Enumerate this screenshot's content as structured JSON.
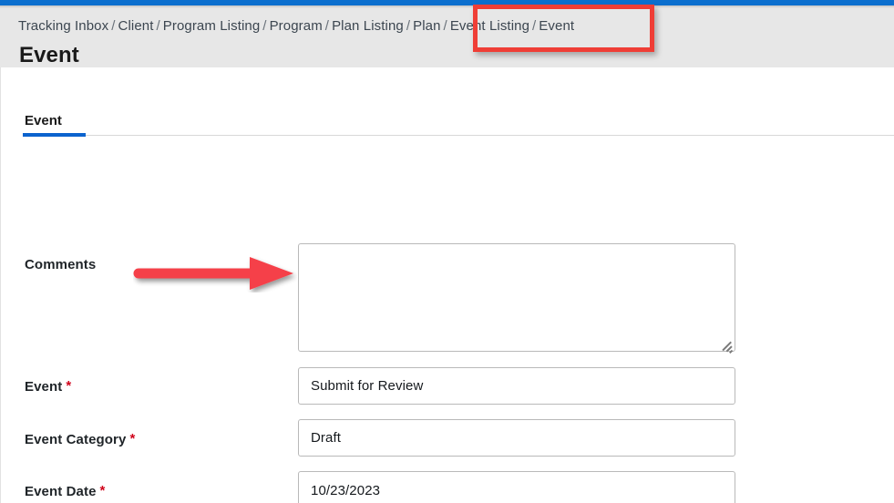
{
  "window": {
    "accent_blue": "#0b6fce",
    "header_bg": "#e7e7e7",
    "annotation_red": "#ef3e36",
    "required_red": "#d0021b"
  },
  "breadcrumb": {
    "separator": "/",
    "items": [
      {
        "label": "Tracking Inbox"
      },
      {
        "label": "Client"
      },
      {
        "label": "Program Listing"
      },
      {
        "label": "Program"
      },
      {
        "label": "Plan Listing"
      },
      {
        "label": "Plan"
      },
      {
        "label": "Event Listing"
      },
      {
        "label": "Event"
      }
    ]
  },
  "header": {
    "title": "Event"
  },
  "tabs": [
    {
      "label": "Event",
      "active": true
    }
  ],
  "form": {
    "fields": [
      {
        "label": "Comments",
        "required": false,
        "type": "textarea",
        "value": "",
        "placeholder": ""
      },
      {
        "label": "Event",
        "required": true,
        "required_marker": "*",
        "type": "text",
        "value": "Submit for Review",
        "placeholder": ""
      },
      {
        "label": "Event Category",
        "required": true,
        "required_marker": "*",
        "type": "text",
        "value": "Draft",
        "placeholder": ""
      },
      {
        "label": "Event Date",
        "required": true,
        "required_marker": "*",
        "type": "text",
        "value": "10/23/2023",
        "placeholder": ""
      }
    ]
  },
  "annotations": {
    "arrow": {
      "icon": "red-arrow-right-icon",
      "points_to": "Comments"
    },
    "box": {
      "icon": "red-highlight-box",
      "surrounds": "Event Listing / Event"
    }
  }
}
